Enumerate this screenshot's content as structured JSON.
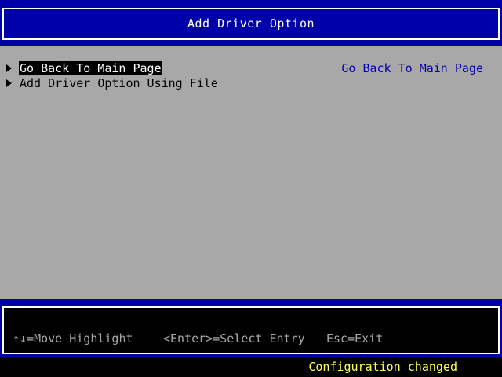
{
  "header": {
    "title": "Add Driver Option"
  },
  "menu": {
    "items": [
      {
        "label": "Go Back To Main Page",
        "selected": true
      },
      {
        "label": "Add Driver Option Using File",
        "selected": false
      }
    ]
  },
  "help": {
    "text": "Go Back To Main Page"
  },
  "footer": {
    "hint_move": "↑↓=Move Highlight",
    "hint_select": "<Enter>=Select Entry",
    "hint_exit": "Esc=Exit"
  },
  "status": {
    "message": "Configuration changed"
  },
  "colors": {
    "header_bg": "#0000a8",
    "body_bg": "#a8a8a8",
    "selection_bg": "#000000",
    "help_text": "#0000a8",
    "status_text": "#ffff55"
  }
}
